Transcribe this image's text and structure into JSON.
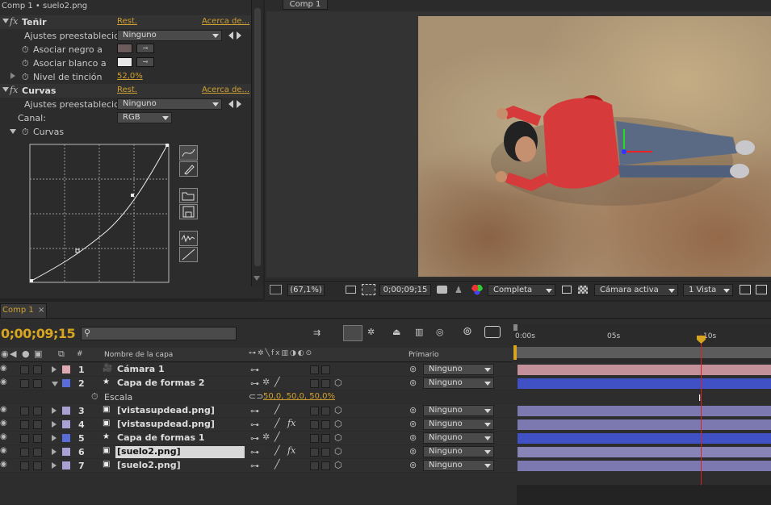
{
  "effects_panel": {
    "title": "Comp 1 • suelo2.png",
    "tenir": {
      "name": "Teñir",
      "reset": "Rest.",
      "about": "Acerca de...",
      "presets_label": "Ajustes preestablecid",
      "presets_value": "Ninguno",
      "map_black": "Asociar negro a",
      "map_white": "Asociar blanco a",
      "amount_label": "Nivel de tinción",
      "amount_value": "52,0%"
    },
    "curvas": {
      "name": "Curvas",
      "reset": "Rest.",
      "about": "Acerca de...",
      "presets_label": "Ajustes preestablecid",
      "presets_value": "Ninguno",
      "channel_label": "Canal:",
      "channel_value": "RGB",
      "curve_label": "Curvas"
    }
  },
  "comp_viewer": {
    "tab": "Comp 1",
    "zoom": "(67,1%)",
    "timecode": "0;00;09;15",
    "resolution": "Completa",
    "camera": "Cámara activa",
    "views": "1 Vista"
  },
  "timeline": {
    "tab": "Comp 1",
    "timecode": "0;00;09;15",
    "search_placeholder": "",
    "col_num": "#",
    "col_name": "Nombre de la capa",
    "col_parent": "Primario",
    "ruler": [
      "0:00s",
      "05s",
      "10s"
    ],
    "layers": [
      {
        "num": "1",
        "name": "Cámara 1",
        "color": "#e0a8b0",
        "parent": "Ninguno",
        "expanded": false,
        "bar": "#c4909a",
        "icon": "camera-icon"
      },
      {
        "num": "2",
        "name": "Capa de formas 2",
        "color": "#5a6cd8",
        "parent": "Ninguno",
        "expanded": true,
        "bar": "#3f51c4",
        "icon": "star-icon"
      },
      {
        "num": "3",
        "name": "[vistasupdead.png]",
        "color": "#a8a2d4",
        "parent": "Ninguno",
        "expanded": false,
        "bar": "#7c78b0",
        "icon": "footage-icon"
      },
      {
        "num": "4",
        "name": "[vistasupdead.png]",
        "color": "#a8a2d4",
        "parent": "Ninguno",
        "expanded": false,
        "bar": "#7c78b0",
        "icon": "footage-icon"
      },
      {
        "num": "5",
        "name": "Capa de formas 1",
        "color": "#5a6cd8",
        "parent": "Ninguno",
        "expanded": false,
        "bar": "#3f51c4",
        "icon": "star-icon"
      },
      {
        "num": "6",
        "name": "[suelo2.png]",
        "color": "#a8a2d4",
        "parent": "Ninguno",
        "expanded": false,
        "bar": "#8884b8",
        "icon": "footage-icon"
      },
      {
        "num": "7",
        "name": "[suelo2.png]",
        "color": "#a8a2d4",
        "parent": "Ninguno",
        "expanded": false,
        "bar": "#7c78b0",
        "icon": "footage-icon"
      }
    ],
    "scale_property": {
      "name": "Escala",
      "value": "50,0, 50,0, 50,0%"
    }
  }
}
